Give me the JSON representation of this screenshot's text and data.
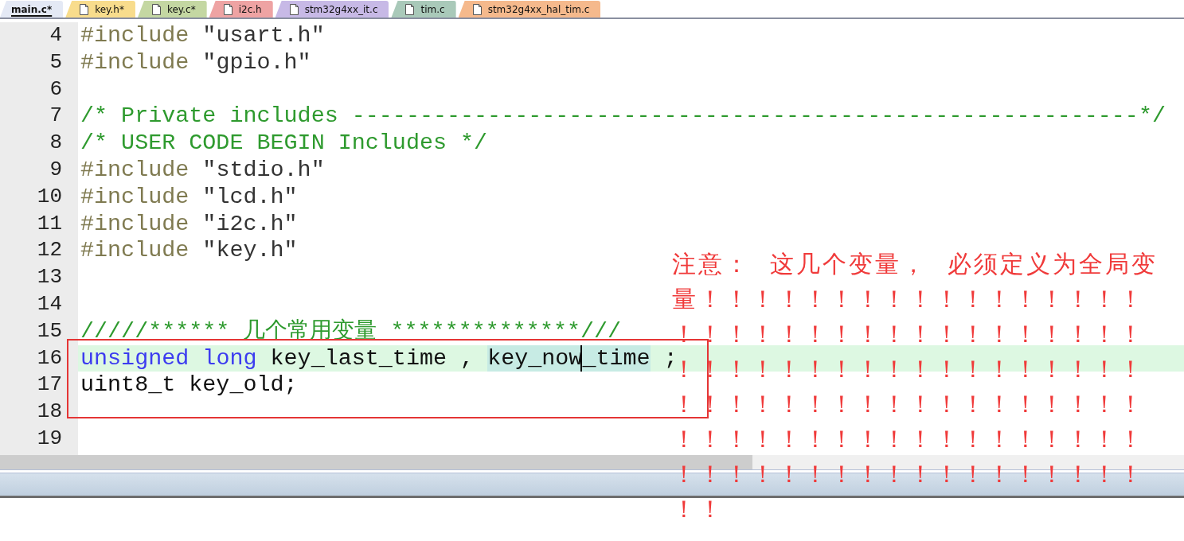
{
  "tabs": [
    {
      "label": "main.c*",
      "selected": true,
      "color": "#e4e9f5"
    },
    {
      "label": "key.h*",
      "selected": false,
      "color": "#f8dc8c"
    },
    {
      "label": "key.c*",
      "selected": false,
      "color": "#c4d7a2"
    },
    {
      "label": "i2c.h",
      "selected": false,
      "color": "#eea3a3"
    },
    {
      "label": "stm32g4xx_it.c",
      "selected": false,
      "color": "#c7b9e6"
    },
    {
      "label": "tim.c",
      "selected": false,
      "color": "#a9c9b9"
    },
    {
      "label": "stm32g4xx_hal_tim.c",
      "selected": false,
      "color": "#f5b98c"
    }
  ],
  "editor": {
    "lines": [
      {
        "number": "4",
        "current": false,
        "tokens": [
          {
            "kind": "directive",
            "text": "#include "
          },
          {
            "kind": "string",
            "text": "\"usart.h\""
          }
        ]
      },
      {
        "number": "5",
        "current": false,
        "tokens": [
          {
            "kind": "directive",
            "text": "#include "
          },
          {
            "kind": "string",
            "text": "\"gpio.h\""
          }
        ]
      },
      {
        "number": "6",
        "current": false
      },
      {
        "number": "7",
        "current": false,
        "tokens": [
          {
            "kind": "comment",
            "text": "/* Private includes ----------------------------------------------------------*/"
          }
        ]
      },
      {
        "number": "8",
        "current": false,
        "tokens": [
          {
            "kind": "comment",
            "text": "/* USER CODE BEGIN Includes */"
          }
        ]
      },
      {
        "number": "9",
        "current": false,
        "tokens": [
          {
            "kind": "directive",
            "text": "#include "
          },
          {
            "kind": "string",
            "text": "\"stdio.h\""
          }
        ]
      },
      {
        "number": "10",
        "current": false,
        "tokens": [
          {
            "kind": "directive",
            "text": "#include "
          },
          {
            "kind": "string",
            "text": "\"lcd.h\""
          }
        ]
      },
      {
        "number": "11",
        "current": false,
        "tokens": [
          {
            "kind": "directive",
            "text": "#include "
          },
          {
            "kind": "string",
            "text": "\"i2c.h\""
          }
        ]
      },
      {
        "number": "12",
        "current": false,
        "tokens": [
          {
            "kind": "directive",
            "text": "#include "
          },
          {
            "kind": "string",
            "text": "\"key.h\""
          }
        ]
      },
      {
        "number": "13",
        "current": false
      },
      {
        "number": "14",
        "current": false
      },
      {
        "number": "15",
        "current": false,
        "tokens": [
          {
            "kind": "comment",
            "text": "/////****** 几个常用变量 **************///"
          }
        ]
      },
      {
        "number": "16",
        "current": true,
        "tokens": [
          {
            "kind": "keyword",
            "text": "unsigned "
          },
          {
            "kind": "keyword",
            "text": "long "
          },
          {
            "kind": "plain",
            "text": "key_last_time , "
          },
          {
            "kind": "plain",
            "text": "key_now",
            "highlighted": true,
            "caret": true
          },
          {
            "kind": "plain",
            "text": "_time",
            "highlighted": true,
            "caret": false
          },
          {
            "kind": "plain",
            "text": " ;"
          }
        ]
      },
      {
        "number": "17",
        "current": false,
        "tokens": [
          {
            "kind": "plain",
            "text": "uint8_t key_old;"
          }
        ]
      },
      {
        "number": "18",
        "current": false
      },
      {
        "number": "19",
        "current": false
      }
    ]
  },
  "annotation": {
    "note": "注意： 这几个变量， 必须定义为全局变量！！！！！！！！！！！！！！！！！！！！！！！！！！！！！！！！！！！！！！！！！！！！！！！！！！！！！！！！！！！！！！！！！！！！！！！！！！！！！！！！！！！！！！！！！！！！！！！！！！！！！！！！！！！！！"
  }
}
